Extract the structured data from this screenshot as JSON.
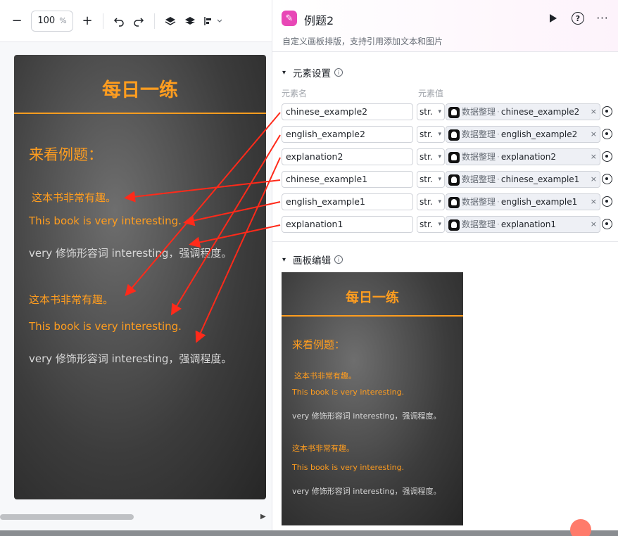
{
  "toolbar": {
    "zoom_value": "100",
    "zoom_unit": "%"
  },
  "poster": {
    "title": "每日一练",
    "heading": "来看例题：",
    "chinese_example1": "这本书非常有趣。",
    "english_example1": "This book is very interesting.",
    "explanation1": "very 修饰形容词 interesting，强调程度。",
    "chinese_example2": "这本书非常有趣。",
    "english_example2": "This book is very interesting.",
    "explanation2": "very 修饰形容词 interesting，强调程度。"
  },
  "panel": {
    "title": "例题2",
    "subtitle": "自定义画板排版，支持引用添加文本和图片",
    "element_section": "元素设置",
    "col_name": "元素名",
    "col_value": "元素值",
    "canvas_section": "画板编辑",
    "rows": [
      {
        "name": "chinese_example2",
        "type": "str.",
        "source": "数据整理",
        "field": "chinese_example2"
      },
      {
        "name": "english_example2",
        "type": "str.",
        "source": "数据整理",
        "field": "english_example2"
      },
      {
        "name": "explanation2",
        "type": "str.",
        "source": "数据整理",
        "field": "explanation2"
      },
      {
        "name": "chinese_example1",
        "type": "str.",
        "source": "数据整理",
        "field": "chinese_example1"
      },
      {
        "name": "english_example1",
        "type": "str.",
        "source": "数据整理",
        "field": "english_example1"
      },
      {
        "name": "explanation1",
        "type": "str.",
        "source": "数据整理",
        "field": "explanation1"
      }
    ]
  },
  "colors": {
    "accent_orange": "#ff9d1f",
    "arrow_red": "#ff2a1a",
    "app_icon": "#e847b6"
  }
}
